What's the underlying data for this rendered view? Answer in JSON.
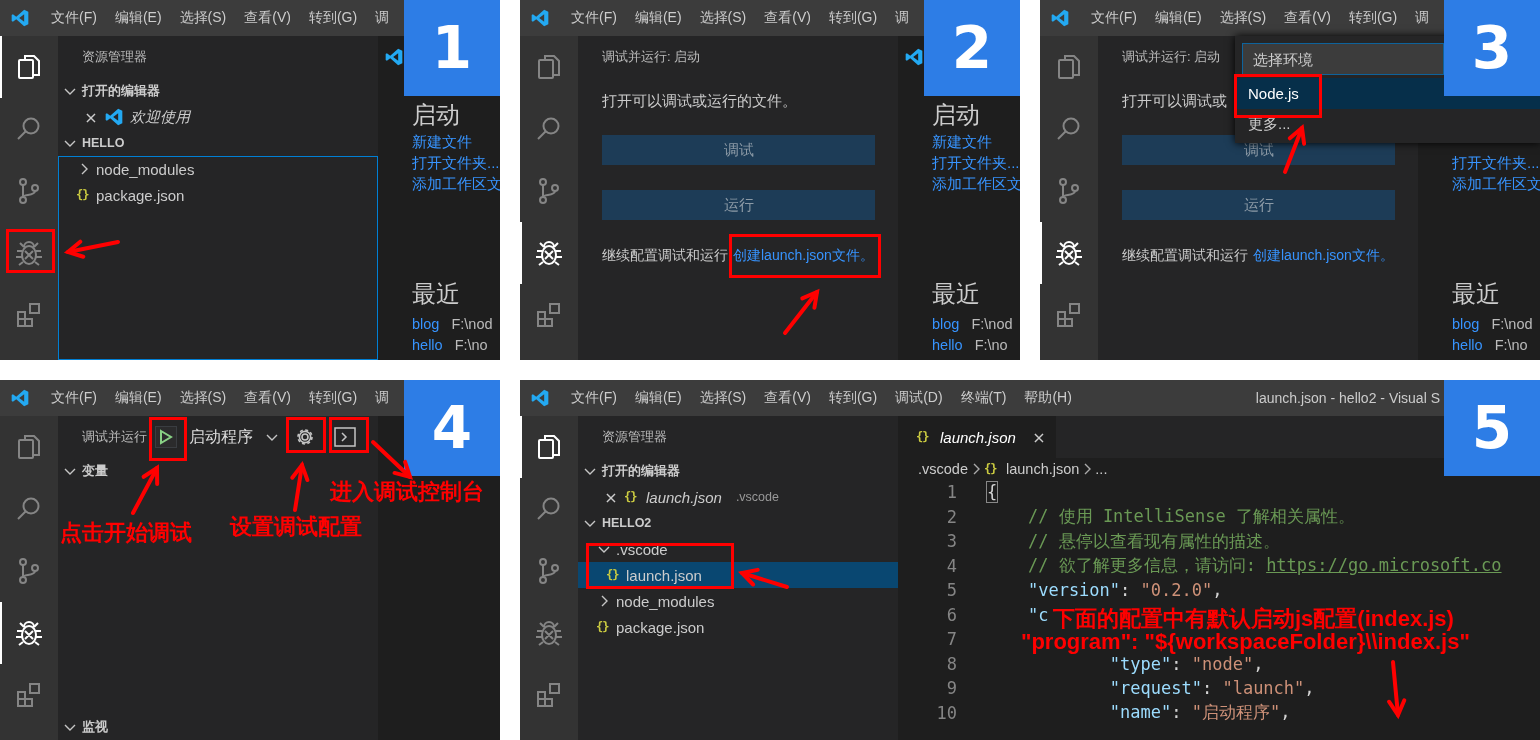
{
  "panels": [
    {
      "step": "1",
      "menu": [
        "文件(F)",
        "编辑(E)",
        "选择(S)",
        "查看(V)",
        "转到(G)",
        "调"
      ],
      "activity_bar": [
        {
          "selected": true
        },
        {
          "selected": false
        },
        {
          "selected": false
        },
        {
          "selected": false
        },
        {
          "selected": false
        }
      ],
      "sidebar": {
        "kind": "explorer",
        "title": "资源管理器",
        "sections": [
          {
            "kind": "open-editors",
            "title": "打开的编辑器",
            "expanded": true,
            "focused": false,
            "items": [
              {
                "kind": "welcome",
                "close": "×",
                "label": "欢迎使用",
                "preview": true
              }
            ]
          },
          {
            "kind": "tree",
            "title": "HELLO",
            "expanded": true,
            "focused": true,
            "items": [
              {
                "kind": "folder",
                "label": "node_modules",
                "expanded": false,
                "selected": false
              },
              {
                "kind": "file",
                "glyph": "{}",
                "label": "package.json",
                "selected": false
              }
            ]
          }
        ]
      },
      "editor": {
        "kind": "welcome",
        "tabs": [
          {
            "kind": "welcome",
            "selected": true
          }
        ],
        "heading": "启动",
        "links": [
          "新建文件",
          "打开文件夹...",
          "添加工作区文"
        ],
        "recent_heading": "最近",
        "recent": [
          {
            "name": "blog",
            "path": "F:\\nod"
          },
          {
            "name": "hello",
            "path": "F:\\no"
          }
        ]
      },
      "annotations": [
        {
          "kind": "box"
        },
        {
          "kind": "arrow"
        }
      ]
    },
    {
      "step": "2",
      "menu": [
        "文件(F)",
        "编辑(E)",
        "选择(S)",
        "查看(V)",
        "转到(G)",
        "调"
      ],
      "activity_bar": [
        {
          "selected": false
        },
        {
          "selected": false
        },
        {
          "selected": false
        },
        {
          "selected": true
        },
        {
          "selected": false
        }
      ],
      "sidebar": {
        "kind": "debug-start",
        "title": "调试并运行: 启动",
        "message": "打开可以调试或运行的文件。",
        "buttons": [
          "调试",
          "运行"
        ],
        "footer": "继续配置调试和运行",
        "footer_link": "创建launch.json文件。"
      },
      "editor": {
        "kind": "welcome",
        "tabs": [
          {
            "kind": "welcome",
            "selected": true
          }
        ],
        "heading": "启动",
        "links": [
          "新建文件",
          "打开文件夹...",
          "添加工作区文"
        ],
        "recent_heading": "最近",
        "recent": [
          {
            "name": "blog",
            "path": "F:\\nod"
          },
          {
            "name": "hello",
            "path": "F:\\no"
          }
        ]
      },
      "annotations": [
        {
          "kind": "box"
        },
        {
          "kind": "arrow"
        }
      ]
    },
    {
      "step": "3",
      "menu": [
        "文件(F)",
        "编辑(E)",
        "选择(S)",
        "查看(V)",
        "转到(G)",
        "调"
      ],
      "activity_bar": [
        {
          "selected": false
        },
        {
          "selected": false
        },
        {
          "selected": false
        },
        {
          "selected": true
        },
        {
          "selected": false
        }
      ],
      "sidebar": {
        "kind": "debug-start",
        "title": "调试并运行: 启动",
        "message": "打开可以调试或",
        "buttons": [
          "调试",
          "运行"
        ],
        "footer": "继续配置调试和运行",
        "footer_link": "创建launch.json文件。"
      },
      "editor": {
        "kind": "welcome",
        "links": [
          "打开文件夹...",
          "添加工作区文"
        ],
        "recent_heading": "最近",
        "recent": [
          {
            "name": "blog",
            "path": "F:\\nod"
          },
          {
            "name": "hello",
            "path": "F:\\no"
          }
        ]
      },
      "quick_pick": {
        "placeholder": "选择环境",
        "items": [
          {
            "label": "Node.js",
            "selected": true
          },
          {
            "label": "更多...",
            "selected": false
          }
        ]
      },
      "annotations": [
        {
          "kind": "box"
        },
        {
          "kind": "arrow"
        }
      ]
    },
    {
      "step": "4",
      "menu": [
        "文件(F)",
        "编辑(E)",
        "选择(S)",
        "查看(V)",
        "转到(G)",
        "调"
      ],
      "activity_bar": [
        {
          "selected": false
        },
        {
          "selected": false
        },
        {
          "selected": false
        },
        {
          "selected": true
        },
        {
          "selected": false
        }
      ],
      "sidebar": {
        "kind": "debug-run",
        "title": "调试并运行",
        "config": "启动程序",
        "sections": [
          {
            "title": "变量",
            "expanded": true
          },
          {
            "title": "监视",
            "expanded": true
          }
        ]
      },
      "editor": {
        "kind": "empty"
      },
      "annotations": [
        {
          "kind": "box"
        },
        {
          "kind": "box"
        },
        {
          "kind": "box"
        },
        {
          "kind": "arrow"
        },
        {
          "kind": "note",
          "text": "点击开始调试"
        },
        {
          "kind": "arrow"
        },
        {
          "kind": "note",
          "text": "设置调试配置"
        },
        {
          "kind": "arrow"
        },
        {
          "kind": "note",
          "text": "进入调试控制台"
        }
      ]
    },
    {
      "step": "5",
      "menu": [
        "文件(F)",
        "编辑(E)",
        "选择(S)",
        "查看(V)",
        "转到(G)",
        "调试(D)",
        "终端(T)",
        "帮助(H)"
      ],
      "title": "launch.json - hello2 - Visual S",
      "activity_bar": [
        {
          "selected": true
        },
        {
          "selected": false
        },
        {
          "selected": false
        },
        {
          "selected": false
        },
        {
          "selected": false
        }
      ],
      "sidebar": {
        "kind": "explorer",
        "title": "资源管理器",
        "sections": [
          {
            "kind": "open-editors",
            "title": "打开的编辑器",
            "expanded": true,
            "focused": false,
            "items": [
              {
                "kind": "file",
                "close": "×",
                "glyph": "{}",
                "label": "launch.json",
                "description": ".vscode",
                "preview": true
              }
            ]
          },
          {
            "kind": "tree",
            "title": "HELLO2",
            "expanded": true,
            "focused": false,
            "items": [
              {
                "kind": "folder",
                "label": ".vscode",
                "expanded": true,
                "selected": false,
                "children": [
                  {
                    "kind": "file",
                    "glyph": "{}",
                    "label": "launch.json",
                    "selected": true
                  }
                ]
              },
              {
                "kind": "folder",
                "label": "node_modules",
                "expanded": false,
                "selected": false
              },
              {
                "kind": "file",
                "glyph": "{}",
                "label": "package.json",
                "selected": false
              }
            ]
          }
        ]
      },
      "editor": {
        "kind": "code",
        "tabs": [
          {
            "kind": "file",
            "glyph": "{}",
            "label": "launch.json",
            "preview": true,
            "close": "×",
            "selected": true
          }
        ],
        "breadcrumb": [
          {
            "label": ".vscode"
          },
          {
            "glyph": "{}",
            "label": "launch.json"
          },
          {
            "label": "..."
          }
        ],
        "lines": [
          {
            "number": "1",
            "tokens": [
              {
                "kind": "bracket",
                "text": "{"
              }
            ]
          },
          {
            "number": "2",
            "tokens": [
              {
                "kind": "comment",
                "text": "    // 使用 IntelliSense 了解相关属性。"
              }
            ]
          },
          {
            "number": "3",
            "tokens": [
              {
                "kind": "comment",
                "text": "    // 悬停以查看现有属性的描述。"
              }
            ]
          },
          {
            "number": "4",
            "tokens": [
              {
                "kind": "comment",
                "text": "    // 欲了解更多信息，请访问: "
              },
              {
                "kind": "link",
                "text": "https://go.microsoft.co"
              }
            ]
          },
          {
            "number": "5",
            "tokens": [
              {
                "kind": "key",
                "text": "    \"version\""
              },
              {
                "kind": "punct",
                "text": ": "
              },
              {
                "kind": "string",
                "text": "\"0.2.0\""
              },
              {
                "kind": "punct",
                "text": ","
              }
            ]
          },
          {
            "number": "6",
            "tokens": [
              {
                "kind": "key",
                "text": "    \"c"
              }
            ]
          },
          {
            "number": "7"
          },
          {
            "number": "8",
            "tokens": [
              {
                "kind": "key",
                "text": "            \"type\""
              },
              {
                "kind": "punct",
                "text": ": "
              },
              {
                "kind": "string",
                "text": "\"node\""
              },
              {
                "kind": "punct",
                "text": ","
              }
            ]
          },
          {
            "number": "9",
            "tokens": [
              {
                "kind": "key",
                "text": "            \"request\""
              },
              {
                "kind": "punct",
                "text": ": "
              },
              {
                "kind": "string",
                "text": "\"launch\""
              },
              {
                "kind": "punct",
                "text": ","
              }
            ]
          },
          {
            "number": "10",
            "tokens": [
              {
                "kind": "key",
                "text": "            \"name\""
              },
              {
                "kind": "punct",
                "text": ": "
              },
              {
                "kind": "string",
                "text": "\"启动程序\""
              },
              {
                "kind": "punct",
                "text": ","
              }
            ]
          }
        ]
      },
      "annotations": [
        {
          "kind": "box"
        },
        {
          "kind": "arrow"
        },
        {
          "kind": "note",
          "text": "下面的配置中有默认启动js配置(index.js)"
        },
        {
          "kind": "note",
          "text": "\"program\": \"${workspaceFolder}\\\\index.js\""
        },
        {
          "kind": "arrow"
        }
      ]
    }
  ]
}
